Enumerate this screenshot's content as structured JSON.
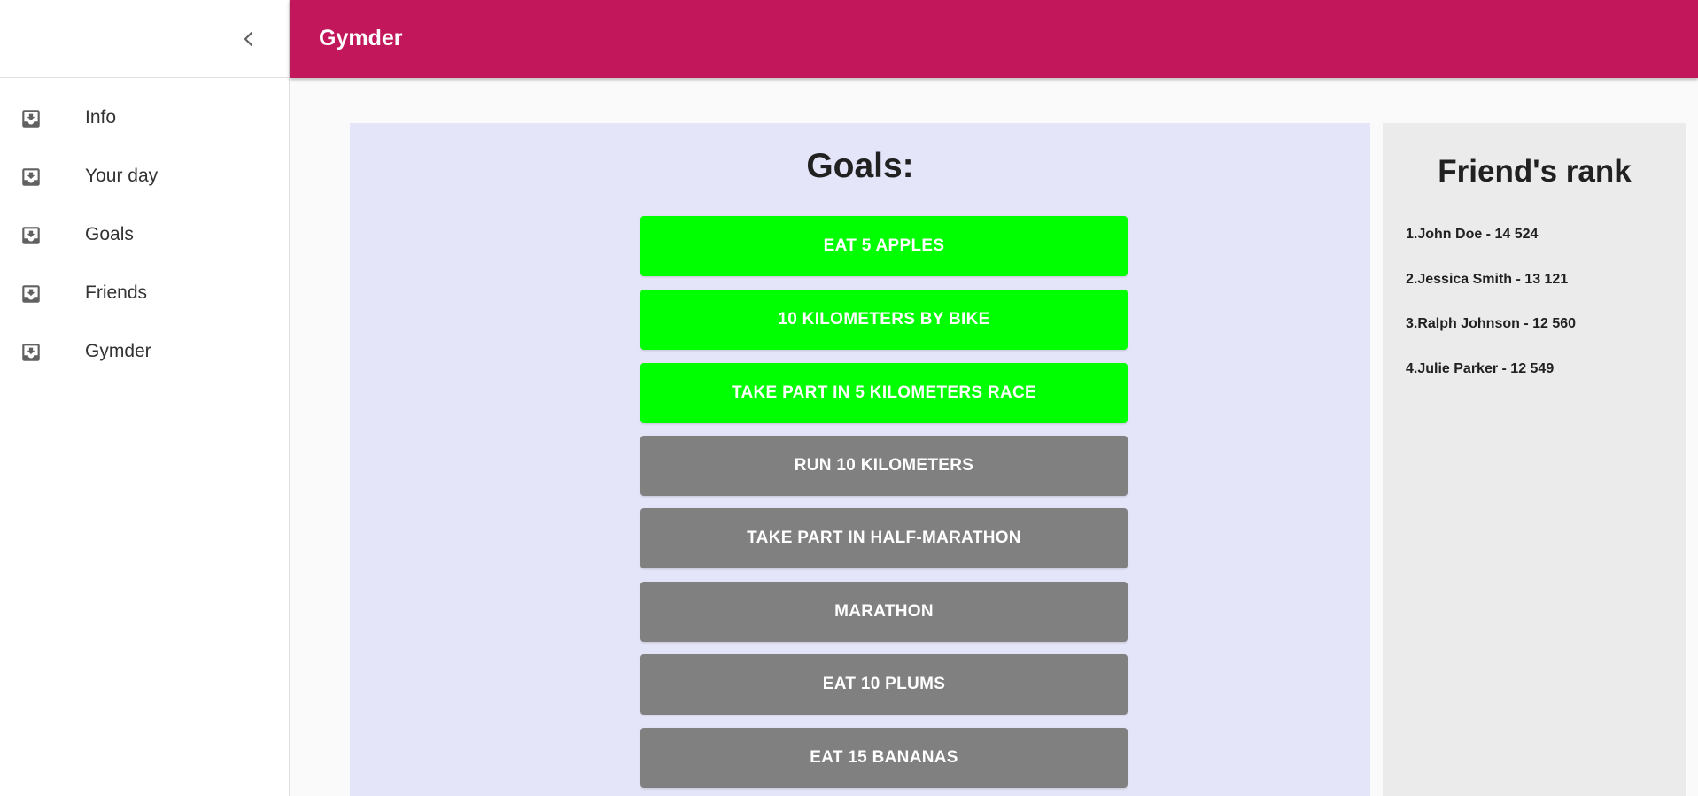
{
  "app": {
    "title": "Gymder"
  },
  "sidebar": {
    "collapse_icon": "chevron-left-icon",
    "items": [
      {
        "label": "Info",
        "icon": "move-to-inbox-icon"
      },
      {
        "label": "Your day",
        "icon": "move-to-inbox-icon"
      },
      {
        "label": "Goals",
        "icon": "move-to-inbox-icon"
      },
      {
        "label": "Friends",
        "icon": "move-to-inbox-icon"
      },
      {
        "label": "Gymder",
        "icon": "move-to-inbox-icon"
      }
    ]
  },
  "goals": {
    "title": "Goals:",
    "items": [
      {
        "label": "Eat 5 apples",
        "status": "completed"
      },
      {
        "label": "10 kilometers by bike",
        "status": "completed"
      },
      {
        "label": "Take part in 5 kilometers race",
        "status": "completed"
      },
      {
        "label": "Run 10 kilometers",
        "status": "pending"
      },
      {
        "label": "Take part in half-marathon",
        "status": "pending"
      },
      {
        "label": "Marathon",
        "status": "pending"
      },
      {
        "label": "Eat 10 plums",
        "status": "pending"
      },
      {
        "label": "Eat 15 bananas",
        "status": "pending"
      }
    ]
  },
  "ranking": {
    "title": "Friend's rank",
    "items": [
      "1.John Doe - 14 524",
      "2.Jessica Smith - 13 121",
      "3.Ralph Johnson - 12 560",
      "4.Julie Parker - 12 549"
    ]
  },
  "colors": {
    "appbar": "#c2185b",
    "completed": "#00ff00",
    "pending": "#808080",
    "goals_panel": "#e4e5f8",
    "rank_panel": "#ebebeb"
  }
}
